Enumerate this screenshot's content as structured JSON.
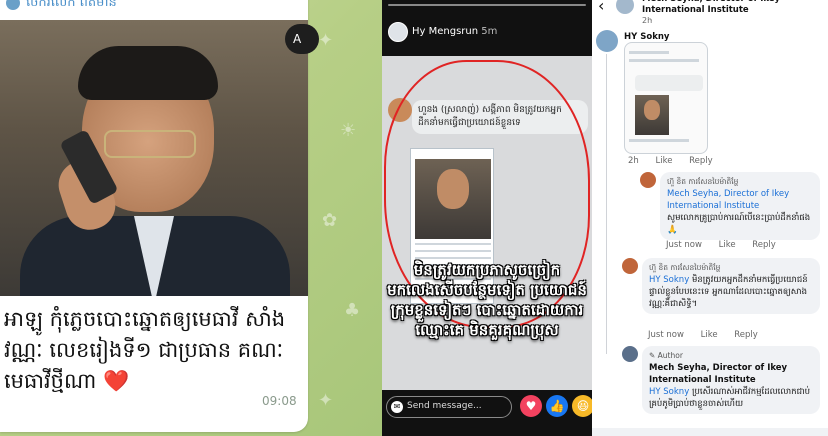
{
  "telegram": {
    "sender_name": "ចែករំលែក ព័ត៌មាន",
    "forward_label": "A",
    "caption": "អាឡូ កុំភ្លេចបោះឆ្នោតឲ្យមេធាវី សាំង វណ្ណៈ លេខរៀងទី១ ជាប្រធាន គណៈមេធាវីថ្មីណា ❤️",
    "time": "09:08"
  },
  "story": {
    "author": "Hy Mengsrun",
    "age": "5m",
    "shared_comment": "ហួនង (ស្រលាញ់) សង្គីភាព មិនត្រូវយកអ្នកដឹកនាំមកធ្វើជាប្រយោជន៍ខ្លួនទេ",
    "overlay_text": "មិនត្រូវយកប្រភាសូចច្រៀក មកលេងសើចបន្ថែមទៀត ប្រយោជន៍ក្រុមខ្លួនទៀតៗ បោះឆ្នោតដោយការ ឈ្មោះគេ មិនគួរគុណប្រុស",
    "composer_placeholder": "Send message...",
    "reactions": [
      "heart",
      "like",
      "haha"
    ]
  },
  "comments": {
    "post_title": "Mech Seyha, Director of Ikey International Institute",
    "post_time": "2h",
    "post_badge": "·",
    "thread": [
      {
        "name": "HY Sokny",
        "has_image": true,
        "time": "2h",
        "like": "Like",
        "reply": "Reply"
      },
      {
        "name": "ហ៊ួ ខិត ការសែនបៃម៉ាតិម្ហែ",
        "tag": "Mech Seyha, Director of Ikey International Institute",
        "text": "សូមលោកគ្រូប្រាប់ការណ៍បើនេះប្រាប់ដឹកនាំផង🙏",
        "time": "Just now",
        "like": "Like",
        "reply": "Reply"
      },
      {
        "name": "ហ៊ួ ខិត ការសែនបៃម៉ាតិម្ហែ",
        "tag": "HY Sokny",
        "text": "មិនត្រូវយកអ្នកដឹកនាំមកធ្វើប្រយោជន៍ផ្ទាល់ខ្លួនបែបនេះទេ អ្នកណាដែលបោះឆ្នោតឲ្យសាងវណ្ណៈគឺជាសិទ្ធិ។",
        "time": "Just now",
        "like": "Like",
        "reply": "Reply"
      },
      {
        "author_badge": "✎ Author",
        "name": "Mech Seyha, Director of Ikey International Institute",
        "tag": "HY Sokny",
        "text": "ប្រសើរណាស់អាជីវកម្មដែលលោកជាប់គ្រប់ភូមិប្រាប់ថាខ្លួនចាស់ហើយ"
      }
    ]
  }
}
